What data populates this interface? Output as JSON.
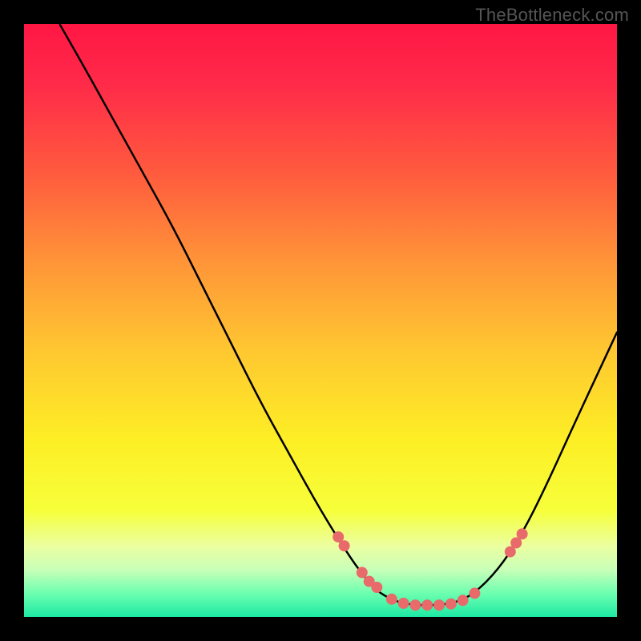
{
  "watermark": "TheBottleneck.com",
  "chart_data": {
    "type": "line",
    "title": "",
    "xlabel": "",
    "ylabel": "",
    "xlim": [
      0,
      100
    ],
    "ylim": [
      0,
      100
    ],
    "curve": {
      "name": "bottleneck-curve",
      "color": "#000000",
      "points": [
        {
          "x": 6,
          "y": 100
        },
        {
          "x": 10,
          "y": 93
        },
        {
          "x": 15,
          "y": 84
        },
        {
          "x": 20,
          "y": 75
        },
        {
          "x": 25,
          "y": 66
        },
        {
          "x": 30,
          "y": 56
        },
        {
          "x": 35,
          "y": 46
        },
        {
          "x": 40,
          "y": 36
        },
        {
          "x": 45,
          "y": 27
        },
        {
          "x": 50,
          "y": 18
        },
        {
          "x": 55,
          "y": 10
        },
        {
          "x": 58,
          "y": 6
        },
        {
          "x": 60,
          "y": 4
        },
        {
          "x": 63,
          "y": 2.5
        },
        {
          "x": 66,
          "y": 2
        },
        {
          "x": 70,
          "y": 2
        },
        {
          "x": 73,
          "y": 2.5
        },
        {
          "x": 76,
          "y": 4
        },
        {
          "x": 80,
          "y": 8
        },
        {
          "x": 84,
          "y": 14
        },
        {
          "x": 88,
          "y": 22
        },
        {
          "x": 93,
          "y": 33
        },
        {
          "x": 100,
          "y": 48
        }
      ]
    },
    "scatter": {
      "name": "highlighted-points",
      "color": "#e86a6a",
      "radius": 7,
      "points": [
        {
          "x": 53,
          "y": 13.5
        },
        {
          "x": 54,
          "y": 12
        },
        {
          "x": 57,
          "y": 7.5
        },
        {
          "x": 58.2,
          "y": 6
        },
        {
          "x": 59.5,
          "y": 5
        },
        {
          "x": 62,
          "y": 3
        },
        {
          "x": 64,
          "y": 2.3
        },
        {
          "x": 66,
          "y": 2
        },
        {
          "x": 68,
          "y": 2
        },
        {
          "x": 70,
          "y": 2
        },
        {
          "x": 72,
          "y": 2.2
        },
        {
          "x": 74,
          "y": 2.8
        },
        {
          "x": 76,
          "y": 4
        },
        {
          "x": 82,
          "y": 11
        },
        {
          "x": 83,
          "y": 12.5
        },
        {
          "x": 84,
          "y": 14
        }
      ]
    },
    "gradient_stops": [
      {
        "offset": 0,
        "color": "#ff1744"
      },
      {
        "offset": 10,
        "color": "#ff2a49"
      },
      {
        "offset": 25,
        "color": "#ff5a3e"
      },
      {
        "offset": 40,
        "color": "#ff9438"
      },
      {
        "offset": 55,
        "color": "#ffc731"
      },
      {
        "offset": 70,
        "color": "#fdee25"
      },
      {
        "offset": 82,
        "color": "#f6ff3a"
      },
      {
        "offset": 88,
        "color": "#ecffa0"
      },
      {
        "offset": 92,
        "color": "#c9ffb8"
      },
      {
        "offset": 96,
        "color": "#6dffb0"
      },
      {
        "offset": 100,
        "color": "#1de9a3"
      }
    ]
  }
}
